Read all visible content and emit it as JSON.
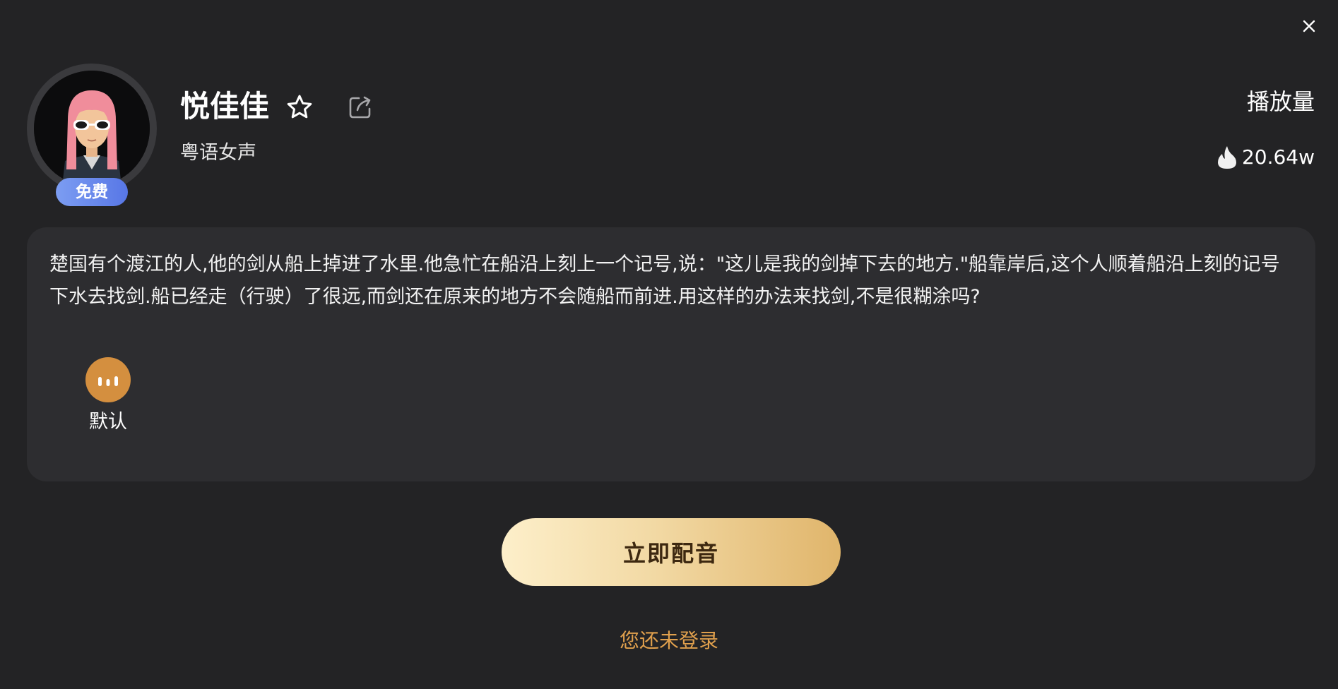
{
  "modal": {
    "close_icon": "close-icon"
  },
  "voice": {
    "name": "悦佳佳",
    "subtitle": "粤语女声",
    "badge": "免费",
    "favorite_icon": "star-outline-icon",
    "share_icon": "share-icon",
    "avatar": "avatar-pink-hair-sunglasses"
  },
  "stats": {
    "plays_label": "播放量",
    "plays_value": "20.64w",
    "plays_icon": "fire-icon"
  },
  "sample": {
    "text": "楚国有个渡江的人,他的剑从船上掉进了水里.他急忙在船沿上刻上一个记号,说：\"这儿是我的剑掉下去的地方.\"船靠岸后,这个人顺着船沿上刻的记号下水去找剑.船已经走（行驶）了很远,而剑还在原来的地方不会随船而前进.用这样的办法来找剑,不是很糊涂吗?"
  },
  "styles": [
    {
      "label": "默认",
      "icon": "audio-bars-icon",
      "color": "#d48f3f"
    }
  ],
  "actions": {
    "dub_label": "立即配音",
    "login_text": "您还未登录"
  },
  "colors": {
    "background": "#232325",
    "panel": "#2d2d30",
    "badge_blue": "#6a8aee",
    "accent_gold": "#e0a04d",
    "style_orange": "#d48f3f"
  }
}
